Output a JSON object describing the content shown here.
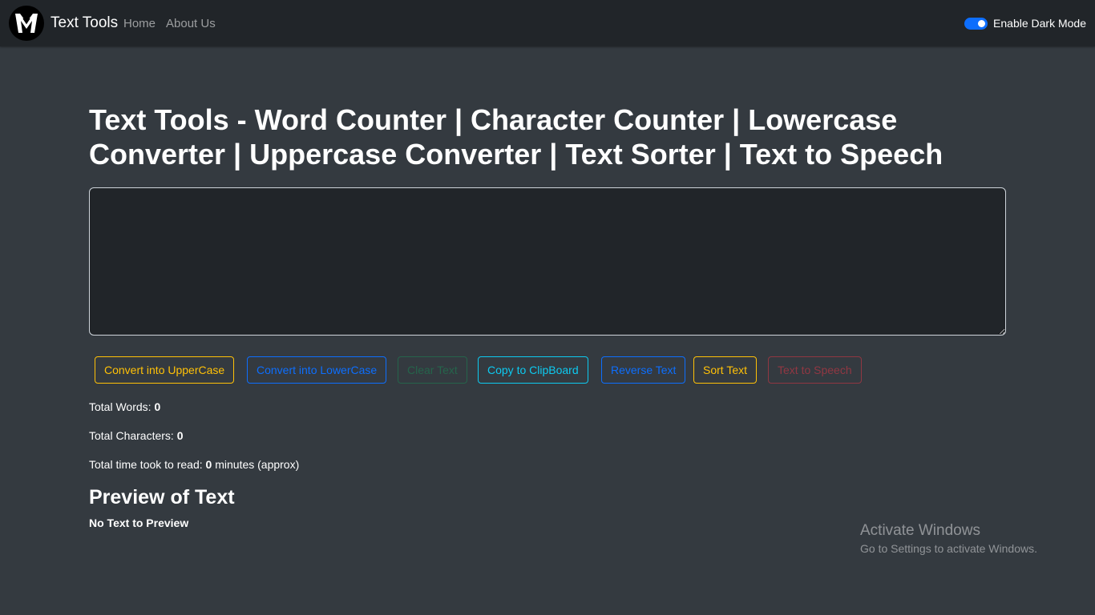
{
  "navbar": {
    "brand": "Text Tools",
    "links": [
      {
        "label": "Home"
      },
      {
        "label": "About Us"
      }
    ],
    "dark_mode_label": "Enable Dark Mode",
    "dark_mode_enabled": true
  },
  "main": {
    "title": "Text Tools - Word Counter | Character Counter | Lowercase Converter | Uppercase Converter | Text Sorter | Text to Speech",
    "textarea": {
      "value": "",
      "placeholder": ""
    },
    "buttons": [
      {
        "label": "Convert into UpperCase",
        "color": "#ffc107"
      },
      {
        "label": "Convert into LowerCase",
        "color": "#0d6efd"
      },
      {
        "label": "Clear Text",
        "color": "#198754"
      },
      {
        "label": "Copy to ClipBoard",
        "color": "#0dcaf0"
      },
      {
        "label": "Reverse Text",
        "color": "#0d6efd"
      },
      {
        "label": "Sort Text",
        "color": "#ffc107"
      },
      {
        "label": "Text to Speech",
        "color": "#dc3545"
      }
    ],
    "stats": {
      "words_label": "Total Words:",
      "words_value": "0",
      "chars_label": "Total Characters:",
      "chars_value": "0",
      "read_label": "Total time took to read:",
      "read_value": "0",
      "read_suffix": "minutes (approx)"
    },
    "preview": {
      "heading": "Preview of Text",
      "text": "No Text to Preview"
    }
  },
  "watermark": {
    "line1": "Activate Windows",
    "line2": "Go to Settings to activate Windows."
  }
}
